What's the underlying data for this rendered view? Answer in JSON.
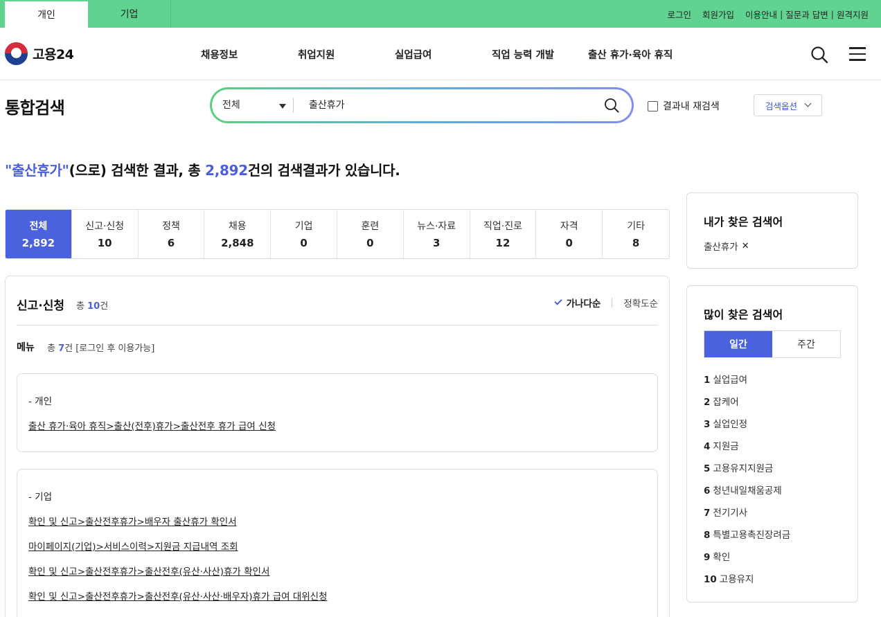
{
  "topbar": {
    "tab_personal": "개인",
    "tab_corporate": "기업",
    "login": "로그인",
    "signup": "회원가입",
    "guide": "이용안내",
    "qna": "질문과 답변",
    "remote": "원격지원",
    "separator": "|"
  },
  "header": {
    "logo_text": "고용24",
    "nav": [
      "채용정보",
      "취업지원",
      "실업급여",
      "직업 능력 개발",
      "출산 휴가·육아 휴직"
    ]
  },
  "search": {
    "page_title": "통합검색",
    "scope": "전체",
    "query": "출산휴가",
    "recheck_label": "결과내 재검색",
    "options_label": "검색옵션"
  },
  "result": {
    "quote_open": "\"",
    "keyword": "출산휴가",
    "quote_close": "\"",
    "middle": "(으로) 검색한 결과, 총 ",
    "total": "2,892",
    "suffix": "건의 검색결과가 있습니다."
  },
  "categories": [
    {
      "label": "전체",
      "count": "2,892"
    },
    {
      "label": "신고·신청",
      "count": "10"
    },
    {
      "label": "정책",
      "count": "6"
    },
    {
      "label": "채용",
      "count": "2,848"
    },
    {
      "label": "기업",
      "count": "0"
    },
    {
      "label": "훈련",
      "count": "0"
    },
    {
      "label": "뉴스·자료",
      "count": "3"
    },
    {
      "label": "직업·진로",
      "count": "12"
    },
    {
      "label": "자격",
      "count": "0"
    },
    {
      "label": "기타",
      "count": "8"
    }
  ],
  "panel": {
    "title": "신고·신청",
    "total_prefix": "총 ",
    "total_count": "10",
    "total_suffix": "건",
    "sort_alpha": "가나다순",
    "sort_accuracy": "정확도순",
    "menu_title": "메뉴",
    "menu_total_prefix": "총 ",
    "menu_total_count": "7",
    "menu_total_suffix": "건 [로그인 후 이용가능]",
    "personal_label": "- 개인",
    "personal_links": [
      "출산 휴가·육아 휴직>출산(전후)휴가>출산전후 휴가 급여 신청"
    ],
    "corporate_label": "- 기업",
    "corporate_links": [
      "확인 및 신고>출산전후휴가>배우자 출산휴가 확인서",
      "마이페이지(기업)>서비스이력>지원금 지급내역 조회",
      "확인 및 신고>출산전후휴가>출산전후(유산·사산)휴가 확인서",
      "확인 및 신고>출산전후휴가>출산전후(유산·사산·배우자)휴가 급여 대위신청"
    ]
  },
  "sidebar": {
    "my_searches_title": "내가 찾은 검색어",
    "my_keyword": "출산휴가",
    "remove_glyph": "✕",
    "popular_title": "많이 찾은 검색어",
    "tab_daily": "일간",
    "tab_weekly": "주간",
    "popular": [
      {
        "rank": "1",
        "term": "실업급여"
      },
      {
        "rank": "2",
        "term": "잡케어"
      },
      {
        "rank": "3",
        "term": "실업인정"
      },
      {
        "rank": "4",
        "term": "지원금"
      },
      {
        "rank": "5",
        "term": "고용유지지원금"
      },
      {
        "rank": "6",
        "term": "청년내일채움공제"
      },
      {
        "rank": "7",
        "term": "전기기사"
      },
      {
        "rank": "8",
        "term": "특별고용촉진장려금"
      },
      {
        "rank": "9",
        "term": "확인"
      },
      {
        "rank": "10",
        "term": "고용유지"
      }
    ]
  },
  "colors": {
    "topbar_green": "#5fd38f",
    "accent_blue": "#4a62dd",
    "highlight_blue": "#4a5fd8"
  },
  "icons": {
    "header_search": "search-icon",
    "header_menu": "hamburger-menu-icon",
    "search_submit": "search-icon",
    "scope_caret": "caret-down-icon",
    "options_chevron": "chevron-down-icon",
    "sort_check": "check-icon",
    "remove_keyword": "close-icon"
  }
}
